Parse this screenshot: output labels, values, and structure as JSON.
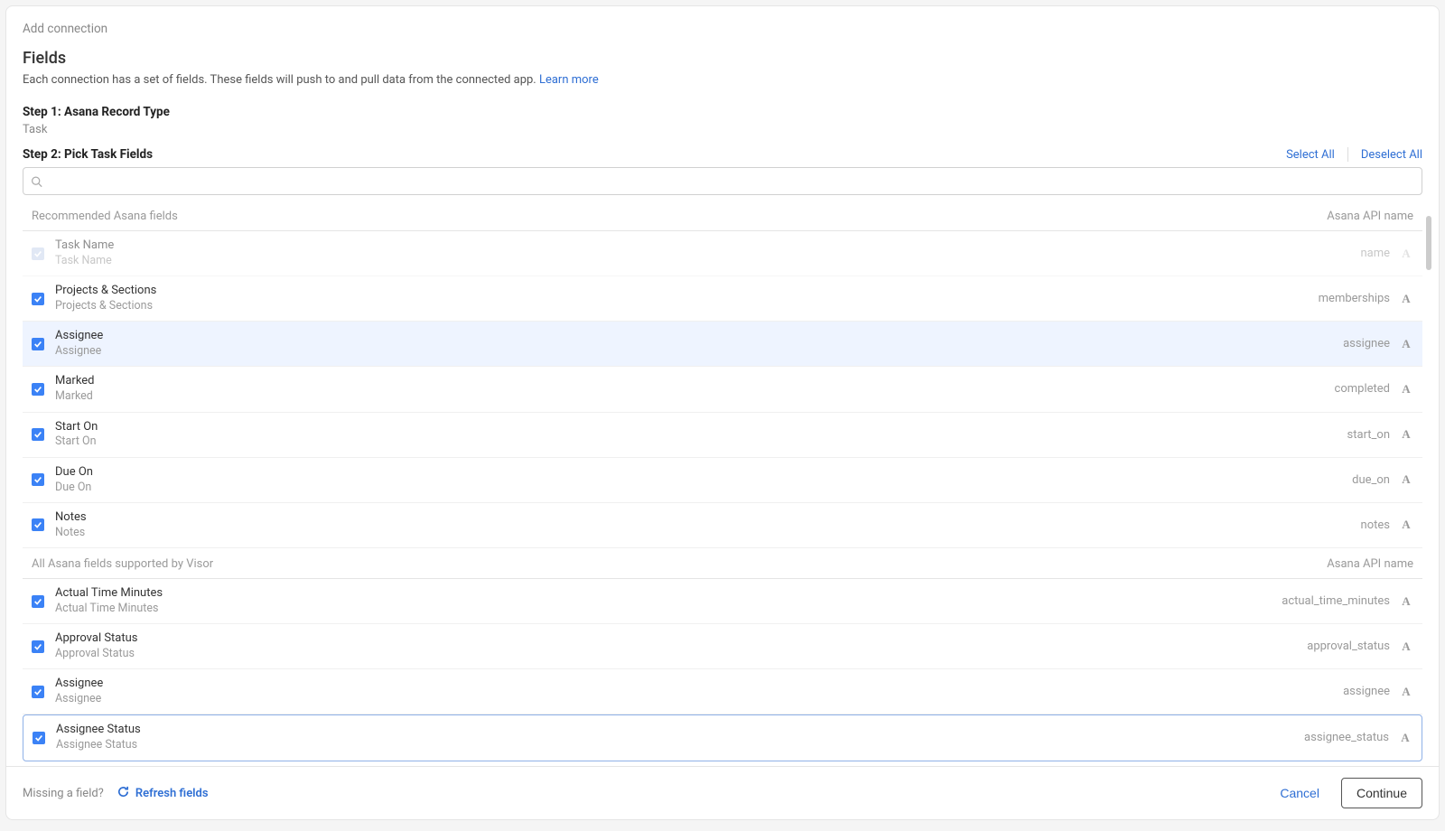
{
  "modal": {
    "title": "Add connection",
    "intro_heading": "Fields",
    "intro_text": "Each connection has a set of fields. These fields will push to and pull data from the connected app. ",
    "learn_more": "Learn more"
  },
  "step1": {
    "label": "Step 1: Asana Record Type",
    "value": "Task"
  },
  "step2": {
    "label": "Step 2: Pick Task Fields",
    "select_all": "Select All",
    "deselect_all": "Deselect All",
    "search_placeholder": ""
  },
  "sections": {
    "recommended": {
      "title": "Recommended Asana fields",
      "api_header": "Asana API name"
    },
    "all": {
      "title": "All Asana fields supported by Visor",
      "api_header": "Asana API name"
    }
  },
  "fields_recommended": [
    {
      "name": "Task Name",
      "sub": "Task Name",
      "api": "name",
      "checked": true,
      "disabled": true
    },
    {
      "name": "Projects & Sections",
      "sub": "Projects & Sections",
      "api": "memberships",
      "checked": true
    },
    {
      "name": "Assignee",
      "sub": "Assignee",
      "api": "assignee",
      "checked": true,
      "highlighted": true
    },
    {
      "name": "Marked",
      "sub": "Marked",
      "api": "completed",
      "checked": true
    },
    {
      "name": "Start On",
      "sub": "Start On",
      "api": "start_on",
      "checked": true
    },
    {
      "name": "Due On",
      "sub": "Due On",
      "api": "due_on",
      "checked": true
    },
    {
      "name": "Notes",
      "sub": "Notes",
      "api": "notes",
      "checked": true
    }
  ],
  "fields_all": [
    {
      "name": "Actual Time Minutes",
      "sub": "Actual Time Minutes",
      "api": "actual_time_minutes",
      "checked": true
    },
    {
      "name": "Approval Status",
      "sub": "Approval Status",
      "api": "approval_status",
      "checked": true
    },
    {
      "name": "Assignee",
      "sub": "Assignee",
      "api": "assignee",
      "checked": true
    },
    {
      "name": "Assignee Status",
      "sub": "Assignee Status",
      "api": "assignee_status",
      "checked": true,
      "selected": true
    }
  ],
  "footer": {
    "missing": "Missing a field?",
    "refresh": "Refresh fields",
    "cancel": "Cancel",
    "continue": "Continue"
  }
}
